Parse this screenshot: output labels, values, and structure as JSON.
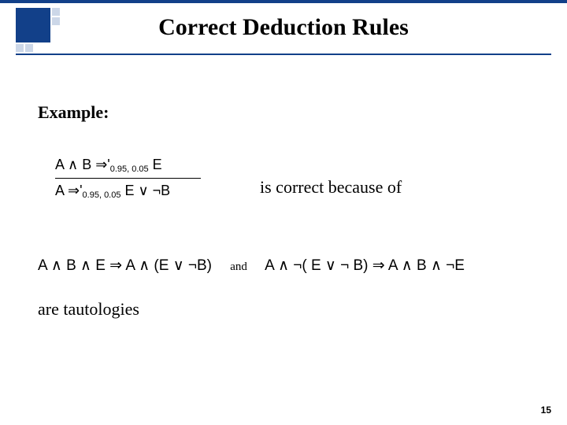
{
  "title": "Correct Deduction Rules",
  "example_label": "Example:",
  "rule": {
    "premise": "A ∧ B ⇒'",
    "premise_sub": "0.95, 0.05",
    "premise_tail": " E",
    "conclusion": "A ⇒'",
    "conclusion_sub": "0.95, 0.05",
    "conclusion_tail": " E ∨ ¬B"
  },
  "correct_text": "is correct  because of",
  "tautology": {
    "left": "A ∧ B ∧ E  ⇒   A ∧ (E ∨ ¬B)",
    "and": "and",
    "right": "A ∧ ¬( E ∨ ¬ B) ⇒ A ∧ B ∧ ¬E"
  },
  "are_tautologies": "are tautologies",
  "page_number": "15"
}
